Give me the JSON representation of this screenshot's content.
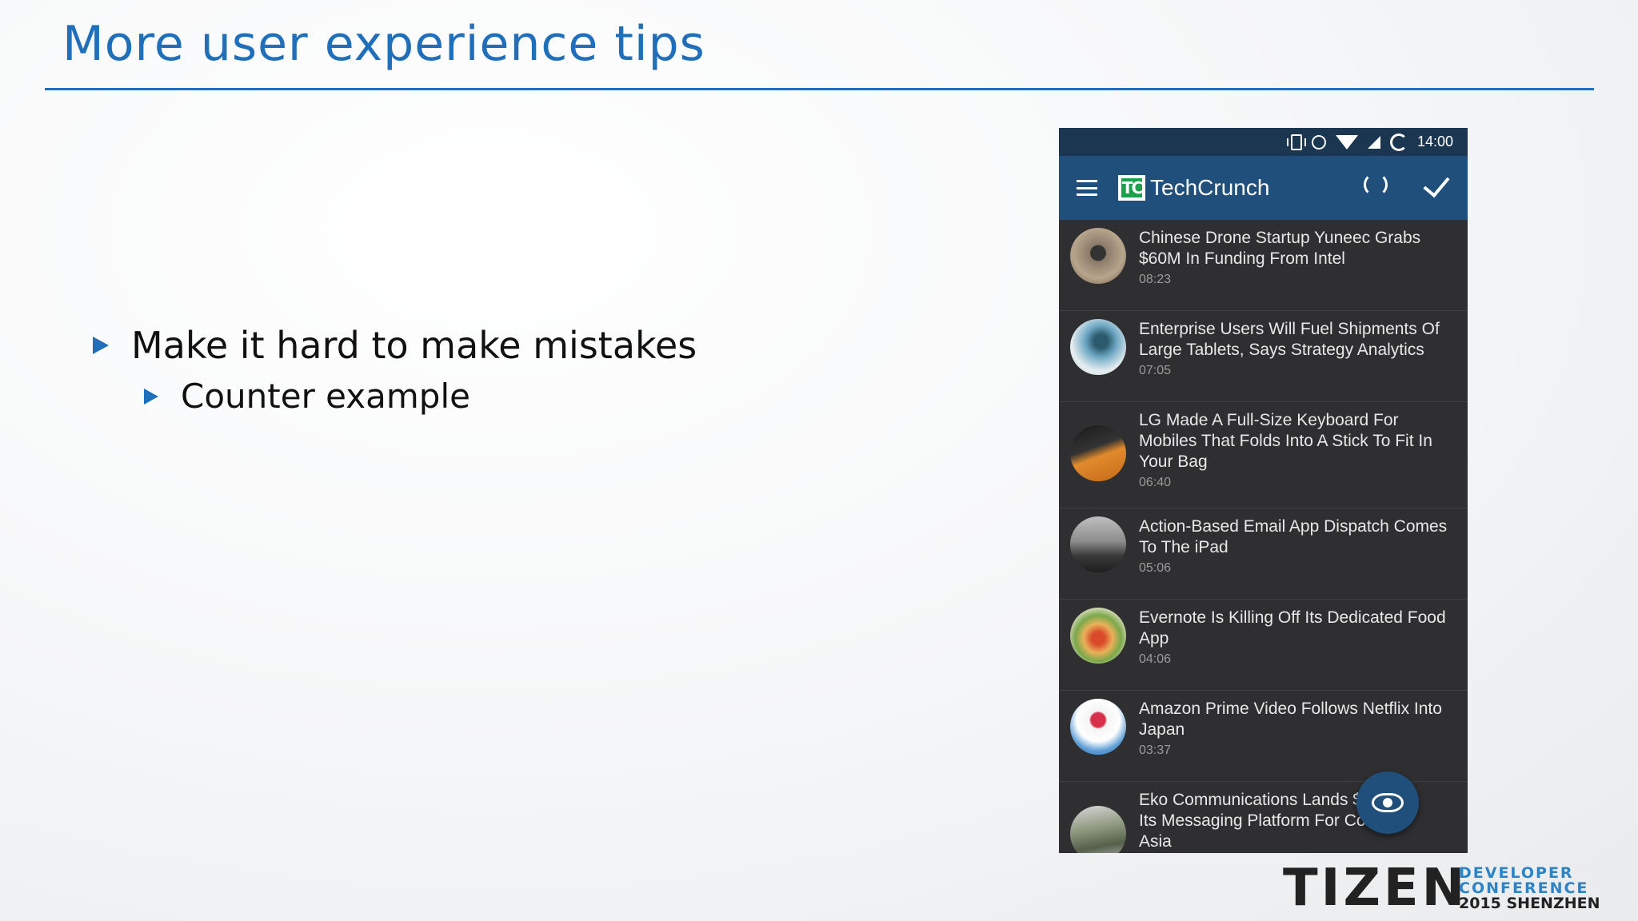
{
  "slide": {
    "title": "More user experience tips",
    "bullets": [
      {
        "text": "Make it hard to make mistakes"
      },
      {
        "text": "Counter example"
      }
    ]
  },
  "phone": {
    "status_bar": {
      "time": "14:00"
    },
    "app_bar": {
      "logo_text": "TC",
      "title": "TechCrunch"
    },
    "news": [
      {
        "headline": "Chinese Drone Startup Yuneec Grabs $60M In Funding From Intel",
        "time": "08:23"
      },
      {
        "headline": "Enterprise Users Will Fuel Shipments Of Large Tablets, Says Strategy Analytics",
        "time": "07:05"
      },
      {
        "headline": "LG Made A Full-Size Keyboard For Mobiles That Folds Into A Stick To Fit In Your Bag",
        "time": "06:40"
      },
      {
        "headline": "Action-Based Email App Dispatch Comes To The iPad",
        "time": "05:06"
      },
      {
        "headline": "Evernote Is Killing Off Its Dedicated Food App",
        "time": "04:06"
      },
      {
        "headline": "Amazon Prime Video Follows Netflix Into Japan",
        "time": "03:37"
      },
      {
        "headline": "Eko Communications Lands $5.7 Its Messaging Platform For Corp In Asia",
        "time": ""
      }
    ]
  },
  "branding": {
    "word": "TIZEN",
    "line1": "DEVELOPER",
    "line2": "CONFERENCE",
    "line3": "2015 SHENZHEN"
  }
}
